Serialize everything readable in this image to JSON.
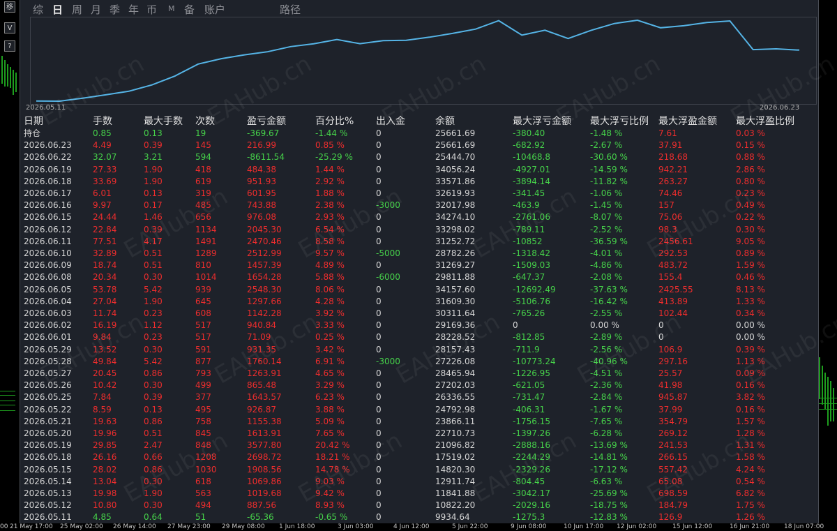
{
  "toolbar": {
    "buttons": [
      "移",
      "V",
      "?"
    ]
  },
  "tabs": [
    {
      "label": "综",
      "active": false
    },
    {
      "label": "日",
      "active": true
    },
    {
      "label": "周",
      "active": false
    },
    {
      "label": "月",
      "active": false
    },
    {
      "label": "季",
      "active": false
    },
    {
      "label": "年",
      "active": false
    },
    {
      "label": "币",
      "active": false
    },
    {
      "label": "M",
      "active": false
    },
    {
      "label": "备",
      "active": false
    },
    {
      "label": "账户",
      "active": false
    },
    {
      "label": "路径",
      "active": false
    }
  ],
  "equity_chart": {
    "start_date": "2026.05.11",
    "end_date": "2026.06.23",
    "line_color": "#55b4e6"
  },
  "colors": {
    "positive": "#46d24a",
    "negative": "#ee2d2d",
    "panel_bg": "#1e222a"
  },
  "watermark": "EAHub.cn",
  "headers": [
    "日期",
    "手数",
    "最大手数",
    "次数",
    "盈亏金额",
    "百分比%",
    "出入金",
    "余额",
    "最大浮亏金额",
    "最大浮亏比例",
    "最大浮盈金额",
    "最大浮盈比例"
  ],
  "rows": [
    {
      "date": "持仓",
      "lots": "0.85",
      "max_lots": "0.13",
      "count": "19",
      "pnl": "-369.67",
      "pct": "-1.44 %",
      "flow": "0",
      "balance": "25661.69",
      "max_dd": "-380.40",
      "max_dd_pct": "-1.48 %",
      "max_fp": "7.61",
      "max_fp_pct": "0.03 %"
    },
    {
      "date": "2026.06.23",
      "lots": "4.49",
      "max_lots": "0.39",
      "count": "145",
      "pnl": "216.99",
      "pct": "0.85 %",
      "flow": "0",
      "balance": "25661.69",
      "max_dd": "-682.92",
      "max_dd_pct": "-2.67 %",
      "max_fp": "37.91",
      "max_fp_pct": "0.15 %"
    },
    {
      "date": "2026.06.22",
      "lots": "32.07",
      "max_lots": "3.21",
      "count": "594",
      "pnl": "-8611.54",
      "pct": "-25.29 %",
      "flow": "0",
      "balance": "25444.70",
      "max_dd": "-10468.8",
      "max_dd_pct": "-30.60 %",
      "max_fp": "218.68",
      "max_fp_pct": "0.88 %"
    },
    {
      "date": "2026.06.19",
      "lots": "27.33",
      "max_lots": "1.90",
      "count": "418",
      "pnl": "484.38",
      "pct": "1.44 %",
      "flow": "0",
      "balance": "34056.24",
      "max_dd": "-4927.01",
      "max_dd_pct": "-14.59 %",
      "max_fp": "942.21",
      "max_fp_pct": "2.86 %"
    },
    {
      "date": "2026.06.18",
      "lots": "33.69",
      "max_lots": "1.90",
      "count": "619",
      "pnl": "951.93",
      "pct": "2.92 %",
      "flow": "0",
      "balance": "33571.86",
      "max_dd": "-3894.14",
      "max_dd_pct": "-11.82 %",
      "max_fp": "263.27",
      "max_fp_pct": "0.80 %"
    },
    {
      "date": "2026.06.17",
      "lots": "6.01",
      "max_lots": "0.13",
      "count": "319",
      "pnl": "601.95",
      "pct": "1.88 %",
      "flow": "0",
      "balance": "32619.93",
      "max_dd": "-341.45",
      "max_dd_pct": "-1.06 %",
      "max_fp": "74.46",
      "max_fp_pct": "0.23 %"
    },
    {
      "date": "2026.06.16",
      "lots": "9.97",
      "max_lots": "0.17",
      "count": "485",
      "pnl": "743.88",
      "pct": "2.38 %",
      "flow": "-3000",
      "balance": "32017.98",
      "max_dd": "-463.9",
      "max_dd_pct": "-1.45 %",
      "max_fp": "157",
      "max_fp_pct": "0.49 %"
    },
    {
      "date": "2026.06.15",
      "lots": "24.44",
      "max_lots": "1.46",
      "count": "656",
      "pnl": "976.08",
      "pct": "2.93 %",
      "flow": "0",
      "balance": "34274.10",
      "max_dd": "-2761.06",
      "max_dd_pct": "-8.07 %",
      "max_fp": "75.06",
      "max_fp_pct": "0.22 %"
    },
    {
      "date": "2026.06.12",
      "lots": "22.84",
      "max_lots": "0.39",
      "count": "1134",
      "pnl": "2045.30",
      "pct": "6.54 %",
      "flow": "0",
      "balance": "33298.02",
      "max_dd": "-789.11",
      "max_dd_pct": "-2.52 %",
      "max_fp": "98.3",
      "max_fp_pct": "0.30 %"
    },
    {
      "date": "2026.06.11",
      "lots": "77.51",
      "max_lots": "4.17",
      "count": "1491",
      "pnl": "2470.46",
      "pct": "8.58 %",
      "flow": "0",
      "balance": "31252.72",
      "max_dd": "-10852",
      "max_dd_pct": "-36.59 %",
      "max_fp": "2456.61",
      "max_fp_pct": "9.05 %"
    },
    {
      "date": "2026.06.10",
      "lots": "32.89",
      "max_lots": "0.51",
      "count": "1289",
      "pnl": "2512.99",
      "pct": "9.57 %",
      "flow": "-5000",
      "balance": "28782.26",
      "max_dd": "-1318.42",
      "max_dd_pct": "-4.01 %",
      "max_fp": "292.53",
      "max_fp_pct": "0.89 %"
    },
    {
      "date": "2026.06.09",
      "lots": "18.74",
      "max_lots": "0.51",
      "count": "810",
      "pnl": "1457.39",
      "pct": "4.89 %",
      "flow": "0",
      "balance": "31269.27",
      "max_dd": "-1509.03",
      "max_dd_pct": "-4.86 %",
      "max_fp": "483.72",
      "max_fp_pct": "1.59 %"
    },
    {
      "date": "2026.06.08",
      "lots": "20.34",
      "max_lots": "0.30",
      "count": "1014",
      "pnl": "1654.28",
      "pct": "5.88 %",
      "flow": "-6000",
      "balance": "29811.88",
      "max_dd": "-647.37",
      "max_dd_pct": "-2.08 %",
      "max_fp": "155.4",
      "max_fp_pct": "0.46 %"
    },
    {
      "date": "2026.06.05",
      "lots": "53.78",
      "max_lots": "5.42",
      "count": "939",
      "pnl": "2548.30",
      "pct": "8.06 %",
      "flow": "0",
      "balance": "34157.60",
      "max_dd": "-12692.49",
      "max_dd_pct": "-37.63 %",
      "max_fp": "2425.55",
      "max_fp_pct": "8.13 %"
    },
    {
      "date": "2026.06.04",
      "lots": "27.04",
      "max_lots": "1.90",
      "count": "645",
      "pnl": "1297.66",
      "pct": "4.28 %",
      "flow": "0",
      "balance": "31609.30",
      "max_dd": "-5106.76",
      "max_dd_pct": "-16.42 %",
      "max_fp": "413.89",
      "max_fp_pct": "1.33 %"
    },
    {
      "date": "2026.06.03",
      "lots": "11.74",
      "max_lots": "0.23",
      "count": "608",
      "pnl": "1142.28",
      "pct": "3.92 %",
      "flow": "0",
      "balance": "30311.64",
      "max_dd": "-765.26",
      "max_dd_pct": "-2.55 %",
      "max_fp": "102.44",
      "max_fp_pct": "0.34 %"
    },
    {
      "date": "2026.06.02",
      "lots": "16.19",
      "max_lots": "1.12",
      "count": "517",
      "pnl": "940.84",
      "pct": "3.33 %",
      "flow": "0",
      "balance": "29169.36",
      "max_dd": "0",
      "max_dd_pct": "0.00 %",
      "max_fp": "0",
      "max_fp_pct": "0.00 %"
    },
    {
      "date": "2026.06.01",
      "lots": "9.84",
      "max_lots": "0.23",
      "count": "517",
      "pnl": "71.09",
      "pct": "0.25 %",
      "flow": "0",
      "balance": "28228.52",
      "max_dd": "-812.85",
      "max_dd_pct": "-2.89 %",
      "max_fp": "0",
      "max_fp_pct": "0.00 %"
    },
    {
      "date": "2026.05.29",
      "lots": "13.52",
      "max_lots": "0.30",
      "count": "591",
      "pnl": "931.35",
      "pct": "3.42 %",
      "flow": "0",
      "balance": "28157.43",
      "max_dd": "-711.9",
      "max_dd_pct": "-2.56 %",
      "max_fp": "106.9",
      "max_fp_pct": "0.39 %"
    },
    {
      "date": "2026.05.28",
      "lots": "49.84",
      "max_lots": "5.42",
      "count": "877",
      "pnl": "1760.14",
      "pct": "6.91 %",
      "flow": "-3000",
      "balance": "27226.08",
      "max_dd": "-10773.24",
      "max_dd_pct": "-40.96 %",
      "max_fp": "297.16",
      "max_fp_pct": "1.13 %"
    },
    {
      "date": "2026.05.27",
      "lots": "20.45",
      "max_lots": "0.86",
      "count": "793",
      "pnl": "1263.91",
      "pct": "4.65 %",
      "flow": "0",
      "balance": "28465.94",
      "max_dd": "-1226.95",
      "max_dd_pct": "-4.51 %",
      "max_fp": "25.57",
      "max_fp_pct": "0.09 %"
    },
    {
      "date": "2026.05.26",
      "lots": "10.42",
      "max_lots": "0.30",
      "count": "499",
      "pnl": "865.48",
      "pct": "3.29 %",
      "flow": "0",
      "balance": "27202.03",
      "max_dd": "-621.05",
      "max_dd_pct": "-2.36 %",
      "max_fp": "41.98",
      "max_fp_pct": "0.16 %"
    },
    {
      "date": "2026.05.25",
      "lots": "7.84",
      "max_lots": "0.39",
      "count": "377",
      "pnl": "1643.57",
      "pct": "6.23 %",
      "flow": "0",
      "balance": "26336.55",
      "max_dd": "-731.47",
      "max_dd_pct": "-2.84 %",
      "max_fp": "945.87",
      "max_fp_pct": "3.82 %"
    },
    {
      "date": "2026.05.22",
      "lots": "8.59",
      "max_lots": "0.13",
      "count": "495",
      "pnl": "926.87",
      "pct": "3.88 %",
      "flow": "0",
      "balance": "24792.98",
      "max_dd": "-406.31",
      "max_dd_pct": "-1.67 %",
      "max_fp": "37.99",
      "max_fp_pct": "0.16 %"
    },
    {
      "date": "2026.05.21",
      "lots": "19.63",
      "max_lots": "0.86",
      "count": "758",
      "pnl": "1155.38",
      "pct": "5.09 %",
      "flow": "0",
      "balance": "23866.11",
      "max_dd": "-1756.15",
      "max_dd_pct": "-7.65 %",
      "max_fp": "354.79",
      "max_fp_pct": "1.57 %"
    },
    {
      "date": "2026.05.20",
      "lots": "19.96",
      "max_lots": "0.51",
      "count": "845",
      "pnl": "1613.91",
      "pct": "7.65 %",
      "flow": "0",
      "balance": "22710.73",
      "max_dd": "-1397.26",
      "max_dd_pct": "-6.28 %",
      "max_fp": "269.12",
      "max_fp_pct": "1.28 %"
    },
    {
      "date": "2026.05.19",
      "lots": "29.85",
      "max_lots": "2.47",
      "count": "848",
      "pnl": "3577.80",
      "pct": "20.42 %",
      "flow": "0",
      "balance": "21096.82",
      "max_dd": "-2888.16",
      "max_dd_pct": "-13.69 %",
      "max_fp": "241.53",
      "max_fp_pct": "1.31 %"
    },
    {
      "date": "2026.05.18",
      "lots": "26.16",
      "max_lots": "0.66",
      "count": "1208",
      "pnl": "2698.72",
      "pct": "18.21 %",
      "flow": "0",
      "balance": "17519.02",
      "max_dd": "-2244.29",
      "max_dd_pct": "-14.81 %",
      "max_fp": "266.15",
      "max_fp_pct": "1.58 %"
    },
    {
      "date": "2026.05.15",
      "lots": "28.02",
      "max_lots": "0.86",
      "count": "1030",
      "pnl": "1908.56",
      "pct": "14.78 %",
      "flow": "0",
      "balance": "14820.30",
      "max_dd": "-2329.26",
      "max_dd_pct": "-17.12 %",
      "max_fp": "557.42",
      "max_fp_pct": "4.24 %"
    },
    {
      "date": "2026.05.14",
      "lots": "13.04",
      "max_lots": "0.30",
      "count": "618",
      "pnl": "1069.86",
      "pct": "9.03 %",
      "flow": "0",
      "balance": "12911.74",
      "max_dd": "-804.45",
      "max_dd_pct": "-6.63 %",
      "max_fp": "65.08",
      "max_fp_pct": "0.54 %"
    },
    {
      "date": "2026.05.13",
      "lots": "19.98",
      "max_lots": "1.90",
      "count": "563",
      "pnl": "1019.68",
      "pct": "9.42 %",
      "flow": "0",
      "balance": "11841.88",
      "max_dd": "-3042.17",
      "max_dd_pct": "-25.69 %",
      "max_fp": "698.59",
      "max_fp_pct": "6.82 %"
    },
    {
      "date": "2026.05.12",
      "lots": "10.80",
      "max_lots": "0.30",
      "count": "494",
      "pnl": "887.56",
      "pct": "8.93 %",
      "flow": "0",
      "balance": "10822.20",
      "max_dd": "-2029.16",
      "max_dd_pct": "-18.75 %",
      "max_fp": "184.79",
      "max_fp_pct": "1.75 %"
    },
    {
      "date": "2026.05.11",
      "lots": "4.85",
      "max_lots": "0.64",
      "count": "51",
      "pnl": "-65.36",
      "pct": "-0.65 %",
      "flow": "0",
      "balance": "9934.64",
      "max_dd": "-1275.3",
      "max_dd_pct": "-12.83 %",
      "max_fp": "126.9",
      "max_fp_pct": "1.26 %"
    }
  ],
  "bottom_axis": [
    "00",
    "21 May 17:00",
    "25 May 02:00",
    "26 May 14:00",
    "27 May 23:00",
    "29 May 08:00",
    "1 Jun 18:00",
    "3 Jun 03:00",
    "4 Jun 12:00",
    "5 Jun 22:00",
    "9 Jun 08:00",
    "10 Jun 17:00",
    "12 Jun 02:00",
    "15 Jun 12:00",
    "16 Jun 21:00",
    "18 Jun 07:00"
  ]
}
